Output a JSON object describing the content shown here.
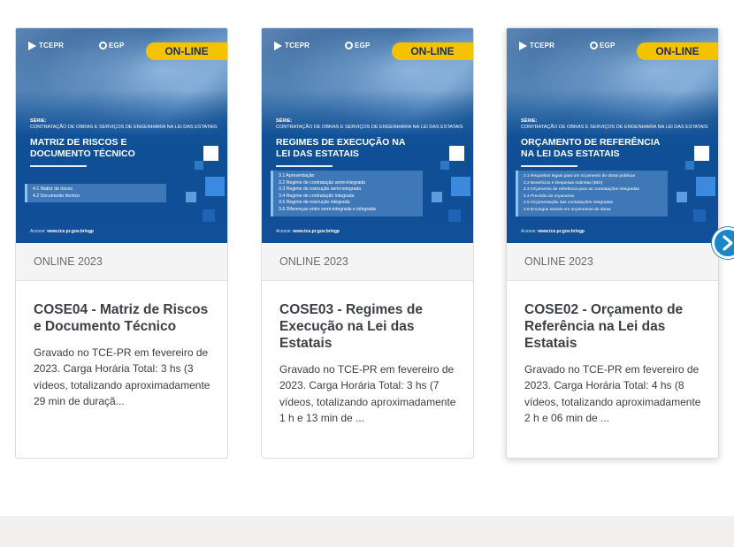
{
  "cards": [
    {
      "badge": "ON-LINE",
      "logo_left": "TCEPR",
      "logo_right": "EGP",
      "serie_label": "SÉRIE:",
      "serie_text": "CONTRATAÇÃO DE OBRAS E SERVIÇOS DE ENGENHARIA NA LEI DAS ESTATAIS",
      "cover_title_1": "MATRIZ DE RISCOS E",
      "cover_title_2": "DOCUMENTO TÉCNICO",
      "toc": [
        "4.1 Matriz de riscos",
        "4.2 Documento técnico"
      ],
      "acesse_label": "Acesse:",
      "acesse_url": "www.tce.pr.gov.br/egp",
      "category": "ONLINE 2023",
      "title": "COSE04 - Matriz de Riscos e Documento Técnico",
      "description": "Gravado no TCE-PR em fevereiro de 2023. Carga Horária Total: 3 hs (3 vídeos, totalizando aproximadamente 29 min de duraçã..."
    },
    {
      "badge": "ON-LINE",
      "logo_left": "TCEPR",
      "logo_right": "EGP",
      "serie_label": "SÉRIE:",
      "serie_text": "CONTRATAÇÃO DE OBRAS E SERVIÇOS DE ENGENHARIA NA LEI DAS ESTATAIS",
      "cover_title_1": "REGIMES DE EXECUÇÃO NA",
      "cover_title_2": "LEI DAS ESTATAIS",
      "toc": [
        "3.1 Apresentação",
        "3.2 Regime de contratação semi-integrada",
        "3.3 Regime de execução semi-integrada",
        "3.4 Regime de contratação integrada",
        "3.5 Regime de execução integrada",
        "3.6 Diferenças entre semi-integrada e integrada"
      ],
      "acesse_label": "Acesse:",
      "acesse_url": "www.tce.pr.gov.br/egp",
      "category": "ONLINE 2023",
      "title": "COSE03 - Regimes de Execução na Lei das Estatais",
      "description": "Gravado no TCE-PR em fevereiro de 2023. Carga Horária Total: 3 hs (7 vídeos, totalizando aproximadamente 1 h e 13 min de ..."
    },
    {
      "badge": "ON-LINE",
      "logo_left": "TCEPR",
      "logo_right": "EGP",
      "serie_label": "SÉRIE:",
      "serie_text": "CONTRATAÇÃO DE OBRAS E SERVIÇOS DE ENGENHARIA NA LEI DAS ESTATAIS",
      "cover_title_1": "ORÇAMENTO DE REFERÊNCIA",
      "cover_title_2": "NA LEI DAS ESTATAIS",
      "toc": [
        "2.1 Requisitos legais para um orçamento de obras públicas",
        "2.2 Benefícios e Despesas Indiretas (BDI)",
        "2.3 Orçamento de referência para as contratações integradas",
        "2.4 Precisão do orçamento",
        "2.5 Orçamentação das contratações integradas",
        "2.6 Encargos sociais em orçamentos de obras"
      ],
      "acesse_label": "Acesse:",
      "acesse_url": "www.tce.pr.gov.br/egp",
      "category": "ONLINE 2023",
      "title": "COSE02 - Orçamento de Referência na Lei das Estatais",
      "description": "Gravado no TCE-PR em fevereiro de 2023. Carga Horária Total: 4 hs (8 vídeos, totalizando aproximadamente 2 h e 06 min de ..."
    }
  ],
  "navigation": {
    "next_icon": "chevron-right-icon"
  },
  "colors": {
    "badge": "#f5c200",
    "cover_blue": "#114f98",
    "nav_blue": "#1b85c8"
  }
}
